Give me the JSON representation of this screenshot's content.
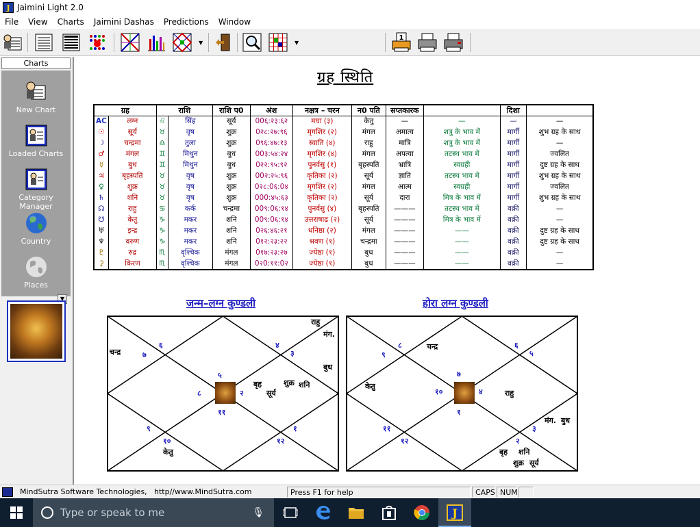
{
  "window": {
    "title": "Jaimini Light 2.0",
    "app_icon_letter": "J"
  },
  "menu": [
    "File",
    "View",
    "Charts",
    "Jaimini Dashas",
    "Predictions",
    "Window"
  ],
  "toolbar": {
    "buttons": [
      "user-chart-icon",
      "list-icon",
      "table-icon",
      "dots-grid-icon",
      "cross-chart-icon",
      "bar-chart-icon",
      "diamond-grid-icon",
      "exit-door-icon",
      "magnify-icon",
      "grid-icon",
      "print-one-icon",
      "printer-icon",
      "fax-printer-icon"
    ]
  },
  "sidebar": {
    "header": "Charts",
    "items": [
      {
        "label": "New Chart",
        "icon": "new-chart-icon"
      },
      {
        "label": "Loaded Charts",
        "icon": "loaded-charts-icon"
      },
      {
        "label": "Category Manager",
        "icon": "category-manager-icon"
      },
      {
        "label": "Country",
        "icon": "globe-icon"
      },
      {
        "label": "Places",
        "icon": "places-globe-icon"
      }
    ]
  },
  "main": {
    "heading": "ग्रह स्थिति",
    "table": {
      "headers": [
        "ग्रह",
        "राशि",
        "राशि प0",
        "अंश",
        "नक्षत्र – चरन",
        "न0 पति",
        "सप्तकारक",
        "",
        "दिशा",
        ""
      ],
      "rows": [
        {
          "sym": "AC",
          "color": "#1a2fbf",
          "name": "लग्न",
          "zs": "♌",
          "rashi": "सिंह",
          "lord": "सूर्य",
          "deg": "00६:२३:६२",
          "nak": "मघा (३)",
          "np": "केतु",
          "sk": "—",
          "bhava": "—",
          "disha": "—",
          "state": "—"
        },
        {
          "sym": "☉",
          "color": "#c00000",
          "name": "सूर्य",
          "zs": "♉",
          "rashi": "वृष",
          "lord": "शुक्र",
          "deg": "0२८:२७:९६",
          "nak": "मृगशिर (२)",
          "np": "मंगल",
          "sk": "अमात्य",
          "bhava": "शत्रु के भाव में",
          "disha": "मार्गी",
          "state": "शुभ ग्रह के साथ"
        },
        {
          "sym": "☽",
          "color": "#1a1a9a",
          "name": "चन्द्रमा",
          "zs": "♎",
          "rashi": "तुला",
          "lord": "शुक्र",
          "deg": "0९६:४७:१३",
          "nak": "स्वाति (४)",
          "np": "राहु",
          "sk": "मात्रि",
          "bhava": "शत्रु के भाव में",
          "disha": "मार्गी",
          "state": "—"
        },
        {
          "sym": "♂",
          "color": "#c00000",
          "name": "मंगल",
          "zs": "♊",
          "rashi": "मिथुन",
          "lord": "बुध",
          "deg": "00३:५४:२४",
          "nak": "मृगशिर (४)",
          "np": "मंगल",
          "sk": "अपत्या",
          "bhava": "तटस्थ भाव में",
          "disha": "मार्गी",
          "state": "ज्वलित"
        },
        {
          "sym": "☿",
          "color": "#a07000",
          "name": "बुध",
          "zs": "♊",
          "rashi": "मिथुन",
          "lord": "बुध",
          "deg": "0२२:९५:९२",
          "nak": "पुनर्वसु (१)",
          "np": "बृहस्पति",
          "sk": "भ्रात्रि",
          "bhava": "स्वग्रही",
          "disha": "मार्गी",
          "state": "दुष्ट ग्रह के साथ"
        },
        {
          "sym": "♃",
          "color": "#c00000",
          "name": "बृहस्पति",
          "zs": "♉",
          "rashi": "वृष",
          "lord": "शुक्र",
          "deg": "00२:२५:९६",
          "nak": "कृतिका (२)",
          "np": "सूर्य",
          "sk": "ज्ञाति",
          "bhava": "तटस्थ भाव में",
          "disha": "मार्गी",
          "state": "शुभ ग्रह के साथ"
        },
        {
          "sym": "♀",
          "color": "#0a7a3a",
          "name": "शुक्र",
          "zs": "♉",
          "rashi": "वृष",
          "lord": "शुक्र",
          "deg": "0२८:0६:0४",
          "nak": "मृगशिर (२)",
          "np": "मंगल",
          "sk": "आत्म",
          "bhava": "स्वग्रही",
          "disha": "मार्गी",
          "state": "ज्वलित"
        },
        {
          "sym": "♄",
          "color": "#1a1a9a",
          "name": "शनि",
          "zs": "♉",
          "rashi": "वृष",
          "lord": "शुक्र",
          "deg": "000:४५:६३",
          "nak": "कृतिका (२)",
          "np": "सूर्य",
          "sk": "दारा",
          "bhava": "मित्र के भाव में",
          "disha": "मार्गी",
          "state": "शुभ ग्रह के साथ"
        },
        {
          "sym": "☊",
          "color": "#1a1a9a",
          "name": "राहु",
          "zs": "♋",
          "rashi": "कर्क",
          "lord": "चन्द्रमा",
          "deg": "00९:0६:१४",
          "nak": "पुनर्वसु (४)",
          "np": "बृहस्पति",
          "sk": "———",
          "bhava": "तटस्थ भाव में",
          "disha": "वक्री",
          "state": "—"
        },
        {
          "sym": "☋",
          "color": "#1a1a9a",
          "name": "केतु",
          "zs": "♑",
          "rashi": "मकर",
          "lord": "शनि",
          "deg": "00९:0६:१४",
          "nak": "उत्तराषाढ (२)",
          "np": "सूर्य",
          "sk": "———",
          "bhava": "मित्र के भाव में",
          "disha": "वक्री",
          "state": "—"
        },
        {
          "sym": "♅",
          "color": "#000000",
          "name": "इन्द्र",
          "zs": "♑",
          "rashi": "मकर",
          "lord": "शनि",
          "deg": "0२६:४६:२१",
          "nak": "धनिष्ठा (२)",
          "np": "मंगल",
          "sk": "———",
          "bhava": "——",
          "disha": "वक्री",
          "state": "दुष्ट ग्रह के साथ"
        },
        {
          "sym": "♆",
          "color": "#000000",
          "name": "वरुण",
          "zs": "♑",
          "rashi": "मकर",
          "lord": "शनि",
          "deg": "0१२:२३:२२",
          "nak": "श्रवण (१)",
          "np": "चन्द्रमा",
          "sk": "———",
          "bhava": "——",
          "disha": "वक्री",
          "state": "दुष्ट ग्रह के साथ"
        },
        {
          "sym": "♇",
          "color": "#a07000",
          "name": "रुद्र",
          "zs": "♏",
          "rashi": "वृश्चिक",
          "lord": "मंगल",
          "deg": "0१७:२३:२७",
          "nak": "ज्येष्ठा (१)",
          "np": "बुध",
          "sk": "———",
          "bhava": "——",
          "disha": "वक्री",
          "state": "—"
        },
        {
          "sym": "⚳",
          "color": "#a07000",
          "name": "किरण",
          "zs": "♏",
          "rashi": "वृश्चिक",
          "lord": "मंगल",
          "deg": "0२0:११:0२",
          "nak": "ज्येष्ठा (१)",
          "np": "बुध",
          "sk": "———",
          "bhava": "——",
          "disha": "वक्री",
          "state": "—"
        }
      ]
    },
    "janma_title": "जन्म–लग्न कुण्डली",
    "hora_title": "होरा लग्न कुण्डली",
    "janma": {
      "labels": [
        "राहु",
        "मंग.",
        "बुध",
        "चन्द्र",
        "बृह",
        "सूर्य",
        "शुक्र",
        "शनि",
        "केतु"
      ],
      "numbers": [
        "६",
        "७",
        "५",
        "३",
        "४",
        "८",
        "२",
        "११",
        "९",
        "१",
        "१२",
        "१०"
      ]
    },
    "hora": {
      "labels": [
        "चन्द्र",
        "केतु",
        "राहु",
        "मंग.",
        "बुध",
        "बृह",
        "शनि",
        "शुक्र",
        "सूर्य"
      ],
      "numbers": [
        "८",
        "६",
        "५",
        "७",
        "१०",
        "४",
        "११",
        "१",
        "१२",
        "२",
        "९",
        "३"
      ]
    }
  },
  "statusbar": {
    "company": "MindSutra Software Technologies,",
    "url": "http//www.MindSutra.com",
    "help": "Press F1 for help",
    "caps": "CAPS",
    "num": "NUM"
  },
  "taskbar": {
    "search_placeholder": "Type or speak to me",
    "apps": [
      "task-view-icon",
      "edge-icon",
      "file-explorer-icon",
      "store-icon",
      "chrome-icon",
      "jaimini-icon"
    ]
  }
}
